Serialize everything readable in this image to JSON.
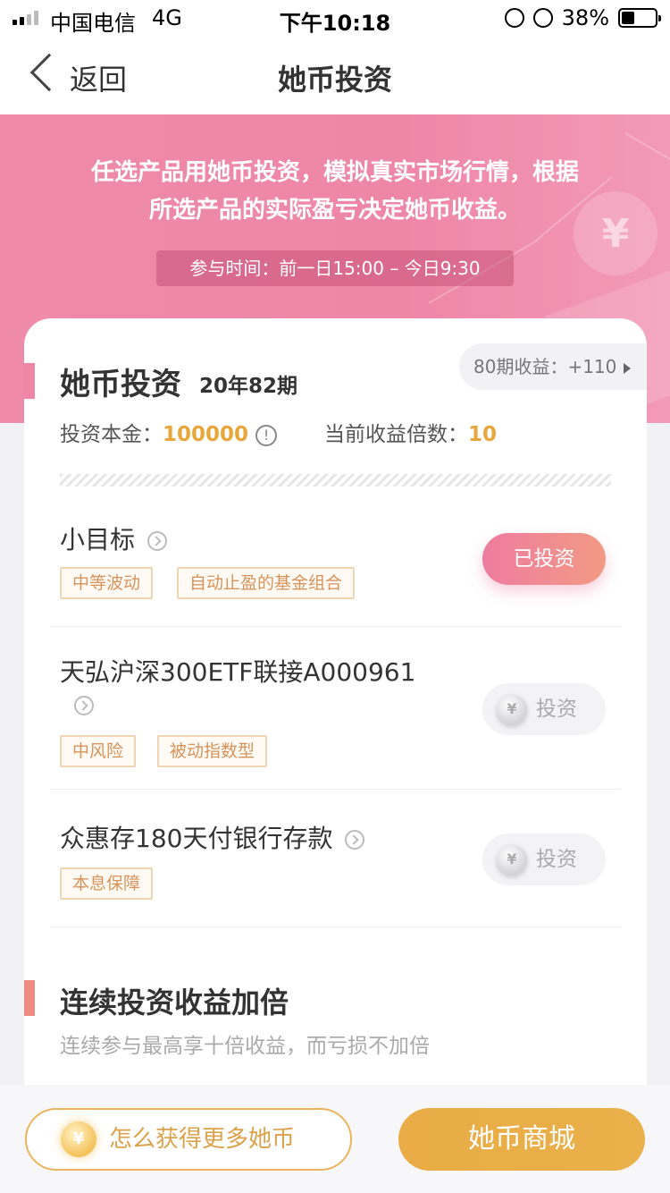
{
  "status_bar": {
    "carrier": "中国电信",
    "network": "4G",
    "time": "下午10:18",
    "battery": "38%"
  },
  "nav": {
    "back_label": "返回",
    "title": "她币投资"
  },
  "banner": {
    "line1": "任选产品用她币投资，模拟真实市场行情，根据",
    "line2": "所选产品的实际盈亏决定她币收益。",
    "time_text": "参与时间：前一日15:00 – 今日9:30",
    "deco_symbol": "¥"
  },
  "card": {
    "title": "她币投资",
    "period": "20年82期",
    "earnings_label": "80期收益：+110",
    "principal_label": "投资本金：",
    "principal_value": "100000",
    "multiplier_label": "当前收益倍数：",
    "multiplier_value": "10",
    "info_glyph": "!"
  },
  "products": [
    {
      "name": "小目标",
      "tags": [
        "中等波动",
        "自动止盈的基金组合"
      ],
      "button": "已投资",
      "invested": true
    },
    {
      "name": "天弘沪深300ETF联接A000961",
      "tags": [
        "中风险",
        "被动指数型"
      ],
      "button": "投资",
      "invested": false
    },
    {
      "name": "众惠存180天付银行存款",
      "tags": [
        "本息保障"
      ],
      "button": "投资",
      "invested": false
    }
  ],
  "coin_symbol": "¥",
  "section2": {
    "title": "连续投资收益加倍",
    "subtitle": "连续参与最高享十倍收益，而亏损不加倍"
  },
  "bottom": {
    "earn_label": "怎么获得更多她币",
    "mall_label": "她币商城"
  },
  "colors": {
    "banner_pink": "#ef8aaa",
    "accent_gold": "#e9a63c",
    "tag_border": "#f1d4b4",
    "tag_text": "#d7935a"
  }
}
